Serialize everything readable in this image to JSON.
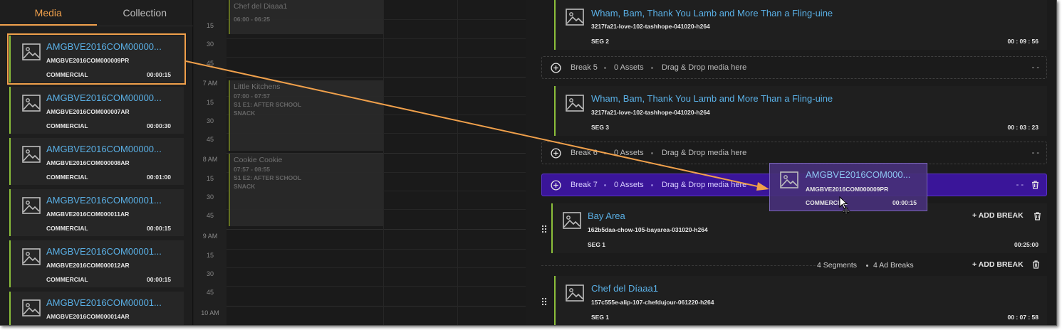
{
  "media_panel": {
    "tabs": [
      {
        "label": "Media",
        "active": true
      },
      {
        "label": "Collection",
        "active": false
      }
    ],
    "items": [
      {
        "title": "AMGBVE2016COM00000...",
        "code": "AMGBVE2016COM000009PR",
        "kind": "COMMERCIAL",
        "duration": "00:00:15",
        "selected": true
      },
      {
        "title": "AMGBVE2016COM00000...",
        "code": "AMGBVE2016COM000007AR",
        "kind": "COMMERCIAL",
        "duration": "00:00:30"
      },
      {
        "title": "AMGBVE2016COM00000...",
        "code": "AMGBVE2016COM000008AR",
        "kind": "COMMERCIAL",
        "duration": "00:01:00"
      },
      {
        "title": "AMGBVE2016COM00001...",
        "code": "AMGBVE2016COM000011AR",
        "kind": "COMMERCIAL",
        "duration": "00:00:15"
      },
      {
        "title": "AMGBVE2016COM00001...",
        "code": "AMGBVE2016COM000012AR",
        "kind": "COMMERCIAL",
        "duration": "00:00:15"
      },
      {
        "title": "AMGBVE2016COM00001...",
        "code": "AMGBVE2016COM000014AR",
        "kind": "",
        "duration": ""
      }
    ]
  },
  "schedule": {
    "time_labels": [
      "15",
      "30",
      "45",
      "7 AM",
      "15",
      "30",
      "45",
      "8 AM",
      "15",
      "30",
      "45",
      "9 AM",
      "15",
      "30",
      "45",
      "10 AM"
    ],
    "blocks": [
      {
        "name": "Chef del Diaaa1",
        "lines": [
          "06:00 - 06:25"
        ]
      },
      {
        "name": "Little Kitchens",
        "lines": [
          "07:00 - 07:57",
          "S1 E1: AFTER SCHOOL",
          "SNACK"
        ]
      },
      {
        "name": "Cookie Cookie",
        "lines": [
          "07:57 - 08:55",
          "S1 E2: AFTER SCHOOL",
          "SNACK"
        ]
      }
    ]
  },
  "playlist": {
    "segments": [
      {
        "title": "Wham, Bam, Thank You Lamb and More Than a Fling-uine",
        "code": "3217fa21-love-102-tashhope-041020-h264",
        "seg": "SEG 2",
        "duration": "00 : 09 : 56"
      },
      {
        "title": "Wham, Bam, Thank You Lamb and More Than a Fling-uine",
        "code": "3217fa21-love-102-tashhope-041020-h264",
        "seg": "SEG 3",
        "duration": "00 : 03 : 23"
      },
      {
        "title": "Bay Area",
        "code": "162b5daa-chow-105-bayarea-031020-h264",
        "seg": "SEG 1",
        "duration": "00:25:00"
      },
      {
        "title": "Chef del Díaaa1",
        "code": "157c555e-alip-107-chefdujour-061220-h264",
        "seg": "SEG 1",
        "duration": "00 : 07 : 58"
      }
    ],
    "breaks": [
      {
        "name": "Break 5",
        "assets": "0 Assets",
        "hint": "Drag & Drop media here",
        "dash": "- -"
      },
      {
        "name": "Break 6",
        "assets": "0 Assets",
        "hint": "Drag & Drop media here",
        "dash": "- -"
      },
      {
        "name": "Break 7",
        "assets": "0 Assets",
        "hint": "Drag & Drop media here",
        "dash": "- -",
        "active": true
      }
    ],
    "add_break_label": "+ ADD BREAK",
    "summary": {
      "segments": "4 Segments",
      "ad_breaks": "4 Ad Breaks"
    }
  },
  "drag_ghost": {
    "title": "AMGBVE2016COM000...",
    "code": "AMGBVE2016COM000009PR",
    "kind": "COMMERCIAL",
    "duration": "00:00:15"
  },
  "colors": {
    "accent": "#f0a04b",
    "link": "#5ab0e6",
    "segment_bar": "#8bbf3a",
    "active_break": "#3a1599",
    "annotation_arrow": "#f0a04b"
  },
  "icons": [
    "image-thumbnail-icon",
    "plus-circle-icon",
    "trash-icon",
    "drag-grip-icon",
    "move-cursor-icon"
  ]
}
